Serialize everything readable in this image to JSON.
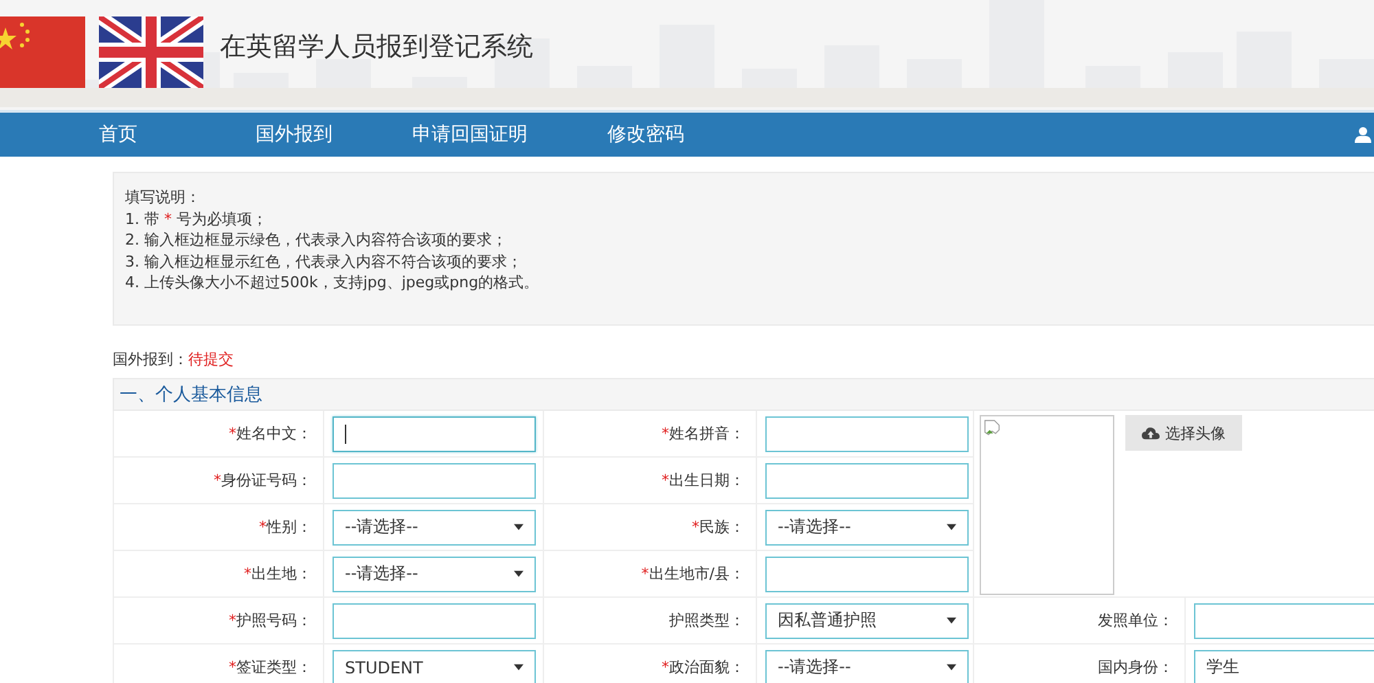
{
  "header": {
    "title": "在英留学人员报到登记系统"
  },
  "nav": {
    "items": [
      {
        "label": "首页",
        "selected": false
      },
      {
        "label": "国外报到",
        "selected": false
      },
      {
        "label": "申请回国证明",
        "selected": false
      },
      {
        "label": "修改密码",
        "selected": false
      }
    ]
  },
  "instructions": {
    "title": "填写说明：",
    "lines": [
      [
        {
          "text": "1. 带 ",
          "red": false
        },
        {
          "text": "*",
          "red": true
        },
        {
          "text": " 号为必填项；",
          "red": false
        }
      ],
      [
        {
          "text": "2. 输入框边框显示绿色，代表录入内容符合该项的要求；",
          "red": false
        }
      ],
      [
        {
          "text": "3. 输入框边框显示红色，代表录入内容不符合该项的要求；",
          "red": false
        }
      ],
      [
        {
          "text": "4. 上传头像大小不超过500k，支持jpg、jpeg或png的格式。",
          "red": false
        }
      ]
    ]
  },
  "status": {
    "label": "国外报到：",
    "value": "待提交"
  },
  "section": {
    "title": "一、个人基本信息"
  },
  "required_mark": "*",
  "photo": {
    "button": "选择头像"
  },
  "rows": [
    [
      {
        "label": "姓名中文：",
        "required": true,
        "field": {
          "kind": "text",
          "focused": true
        }
      },
      {
        "label": "姓名拼音：",
        "required": true,
        "field": {
          "kind": "text",
          "focused": false
        }
      }
    ],
    [
      {
        "label": "身份证号码：",
        "required": true,
        "field": {
          "kind": "text",
          "focused": false
        }
      },
      {
        "label": "出生日期：",
        "required": true,
        "field": {
          "kind": "text",
          "focused": false
        }
      }
    ],
    [
      {
        "label": "性别：",
        "required": true,
        "field": {
          "kind": "select",
          "value": "--请选择--"
        }
      },
      {
        "label": "民族：",
        "required": true,
        "field": {
          "kind": "select",
          "value": "--请选择--"
        }
      }
    ],
    [
      {
        "label": "出生地：",
        "required": true,
        "field": {
          "kind": "select",
          "value": "--请选择--"
        }
      },
      {
        "label": "出生地市/县：",
        "required": true,
        "field": {
          "kind": "text",
          "focused": false
        }
      }
    ],
    [
      {
        "label": "护照号码：",
        "required": true,
        "field": {
          "kind": "text",
          "focused": false
        }
      },
      {
        "label": "护照类型：",
        "required": false,
        "field": {
          "kind": "select",
          "value": "因私普通护照"
        }
      },
      {
        "label": "发照单位：",
        "required": false,
        "field": {
          "kind": "text",
          "focused": false
        }
      }
    ],
    [
      {
        "label": "签证类型：",
        "required": true,
        "field": {
          "kind": "select",
          "value": "STUDENT"
        }
      },
      {
        "label": "政治面貌：",
        "required": true,
        "field": {
          "kind": "select",
          "value": "--请选择--"
        }
      },
      {
        "label": "国内身份：",
        "required": false,
        "field": {
          "kind": "text",
          "value": "学生",
          "focused": false
        }
      }
    ]
  ]
}
